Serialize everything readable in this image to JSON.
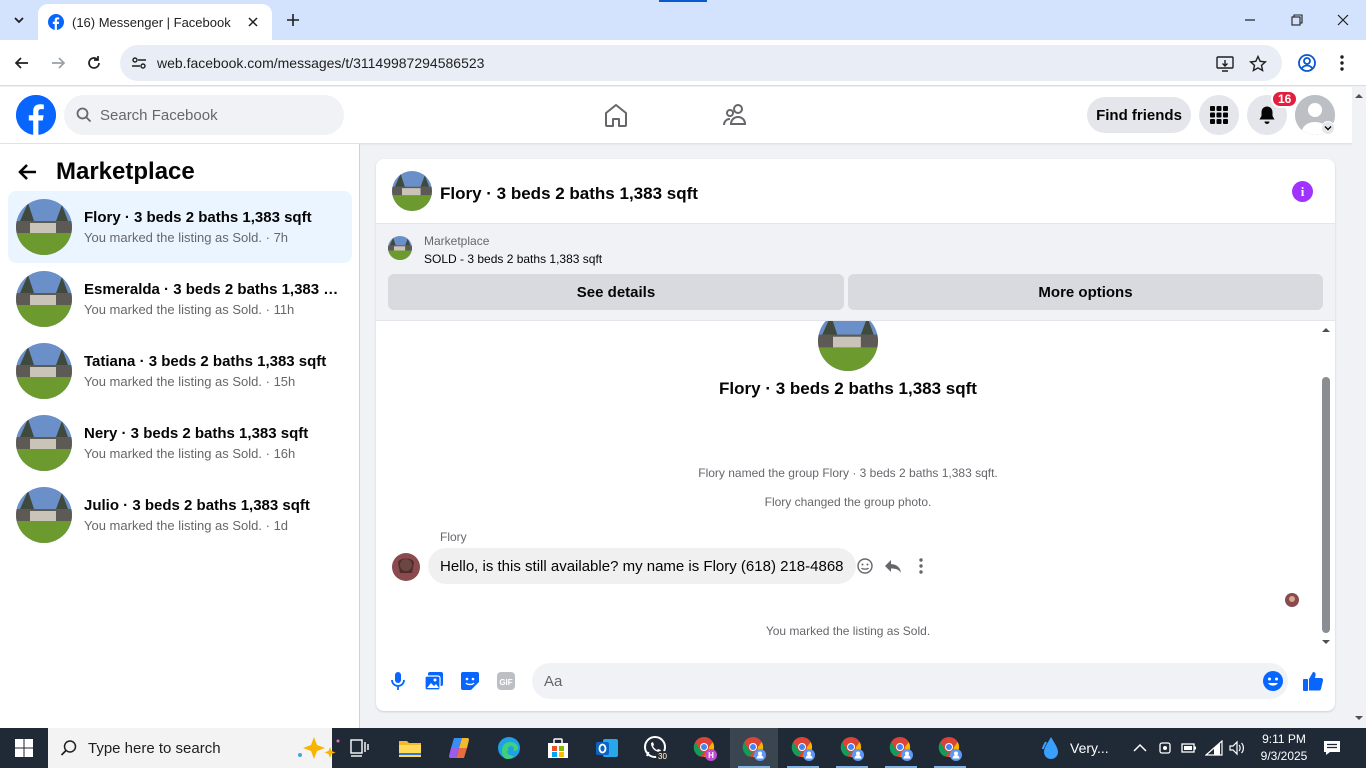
{
  "browser": {
    "tab_title": "(16) Messenger | Facebook",
    "url": "web.facebook.com/messages/t/31149987294586523"
  },
  "fb_header": {
    "search_placeholder": "Search Facebook",
    "find_friends_label": "Find friends",
    "notification_count": "16"
  },
  "sidebar": {
    "title": "Marketplace",
    "conversations": [
      {
        "name": "Flory · 3 beds 2 baths 1,383 sqft",
        "subtitle": "You marked the listing as Sold. · 7h",
        "active": true
      },
      {
        "name": "Esmeralda · 3 beds 2 baths 1,383 s...",
        "subtitle": "You marked the listing as Sold. · 11h",
        "active": false
      },
      {
        "name": "Tatiana · 3 beds 2 baths 1,383 sqft",
        "subtitle": "You marked the listing as Sold. · 15h",
        "active": false
      },
      {
        "name": "Nery · 3 beds 2 baths 1,383 sqft",
        "subtitle": "You marked the listing as Sold. · 16h",
        "active": false
      },
      {
        "name": "Julio · 3 beds 2 baths 1,383 sqft",
        "subtitle": "You marked the listing as Sold. · 1d",
        "active": false
      }
    ]
  },
  "chat": {
    "title": "Flory · 3 beds 2 baths 1,383 sqft",
    "marketplace_label": "Marketplace",
    "listing_status": "SOLD - 3 beds 2 baths 1,383 sqft",
    "see_details_label": "See details",
    "more_options_label": "More options",
    "thread_title": "Flory · 3 beds 2 baths 1,383 sqft",
    "system_messages": [
      "Flory named the group Flory · 3 beds 2 baths 1,383 sqft.",
      "Flory changed the group photo."
    ],
    "sender_name": "Flory",
    "message_text": "Hello, is this still available? my name is Flory (618) 218-4868",
    "sold_notice": "You marked the listing as Sold.",
    "composer_placeholder": "Aa"
  },
  "taskbar": {
    "search_placeholder": "Type here to search",
    "weather_text": "Very...",
    "time": "9:11 PM",
    "date": "9/3/2025",
    "whatsapp_badge": "30"
  },
  "colors": {
    "facebook_blue": "#0866ff",
    "messenger_purple": "#a033ff",
    "notification_red": "#e41e3f",
    "active_conversation_bg": "#ebf5ff"
  }
}
